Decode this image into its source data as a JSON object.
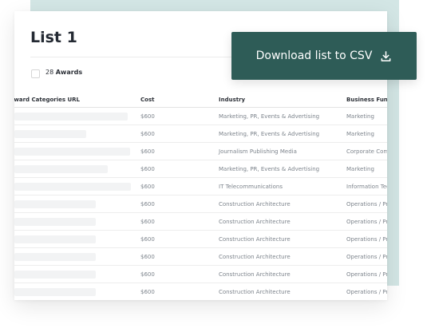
{
  "list": {
    "title": "List 1",
    "awards_count": "28",
    "awards_label": "Awards"
  },
  "download_button": {
    "label": "Download list to CSV",
    "icon": "download-icon"
  },
  "table": {
    "headers": [
      "Award Categories URL",
      "Cost",
      "Industry",
      "Business Function"
    ],
    "rows": [
      {
        "cost": "$600",
        "industry": "Marketing, PR, Events & Advertising",
        "function": "Marketing"
      },
      {
        "cost": "$600",
        "industry": "Marketing, PR, Events & Advertising",
        "function": "Marketing"
      },
      {
        "cost": "$600",
        "industry": "Journalism Publishing Media",
        "function": "Corporate Communications"
      },
      {
        "cost": "$600",
        "industry": "Marketing, PR, Events & Advertising",
        "function": "Marketing"
      },
      {
        "cost": "$600",
        "industry": "IT Telecommunications",
        "function": "Information Technology"
      },
      {
        "cost": "$600",
        "industry": "Construction Architecture",
        "function": "Operations / Production"
      },
      {
        "cost": "$600",
        "industry": "Construction Architecture",
        "function": "Operations / Production"
      },
      {
        "cost": "$600",
        "industry": "Construction Architecture",
        "function": "Operations / Production"
      },
      {
        "cost": "$600",
        "industry": "Construction Architecture",
        "function": "Operations / Production"
      },
      {
        "cost": "$600",
        "industry": "Construction Architecture",
        "function": "Operations / Production"
      },
      {
        "cost": "$600",
        "industry": "Construction Architecture",
        "function": "Operations / Production"
      }
    ]
  },
  "colors": {
    "accent": "#2e5c57",
    "panel": "#d3e6e5"
  }
}
